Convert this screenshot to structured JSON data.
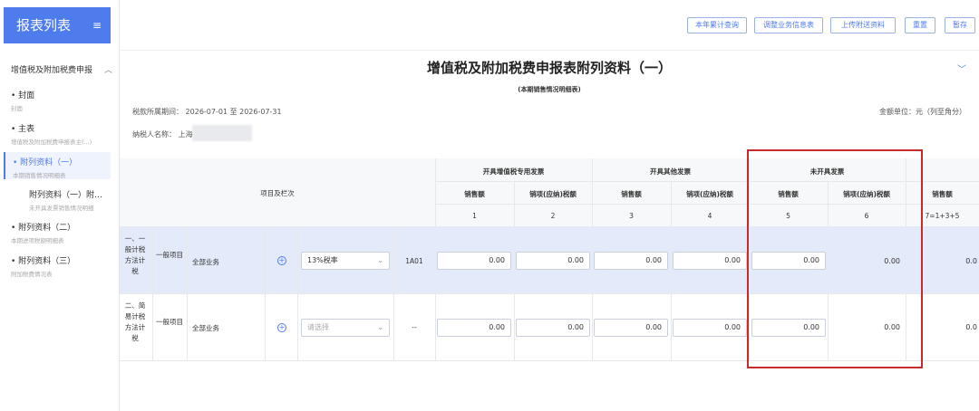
{
  "sidebar": {
    "title": "报表列表",
    "menu_icon": "≡",
    "group": "增值税及附加税费申报",
    "items": [
      {
        "label": "封面",
        "sub": "封面"
      },
      {
        "label": "主表",
        "sub": "增值税及附加税费申报表主(...)"
      },
      {
        "label": "附列资料（一）",
        "sub": "本期销售情况明细表"
      },
      {
        "label": "附列资料（一）附…",
        "sub": "未开具发票销售情况明细"
      },
      {
        "label": "附列资料（二）",
        "sub": "本期进项税额明细表"
      },
      {
        "label": "附列资料（三）",
        "sub": "附加税费情况表"
      }
    ]
  },
  "toolbar": {
    "btn1": "本年累计查询",
    "btn2": "调整业务信息表",
    "btn3": "上传附送资料",
    "btn4": "重置",
    "btn5": "暂存"
  },
  "form": {
    "title": "增值税及附加税费申报表附列资料（一）",
    "subtitle": "(本期销售情况明细表)",
    "period_label": "税款所属期间：",
    "period_value": "2026-07-01 至 2026-07-31",
    "unit_label": "金额单位：元（列至角分）",
    "taxpayer_label": "纳税人名称：",
    "taxpayer_value": "上海"
  },
  "table": {
    "item_header": "项目及栏次",
    "groups": [
      "开具增值税专用发票",
      "开具其他发票",
      "未开具发票"
    ],
    "sub_headers": [
      "销售额",
      "销项(应纳)税额",
      "销售额",
      "销项(应纳)税额",
      "销售额",
      "销项(应纳)税额",
      "销售额"
    ],
    "col_numbers": [
      "1",
      "2",
      "3",
      "4",
      "5",
      "6",
      "7=1+3+5"
    ],
    "rows": [
      {
        "category": "一、一般计税方法计税",
        "type": "一般项目",
        "business": "全部业务",
        "rate": "13%税率",
        "code": "1A01",
        "values": [
          "0.00",
          "0.00",
          "0.00",
          "0.00",
          "0.00",
          "0.00",
          "0.0"
        ]
      },
      {
        "category": "二、简易计税方法计税",
        "type": "一般项目",
        "business": "全部业务",
        "rate": "请选择",
        "code": "--",
        "values": [
          "0.00",
          "0.00",
          "0.00",
          "0.00",
          "0.00",
          "0.00",
          "0.0"
        ]
      }
    ]
  },
  "colors": {
    "accent": "#4f7cec",
    "highlight_box": "#c8292a"
  }
}
